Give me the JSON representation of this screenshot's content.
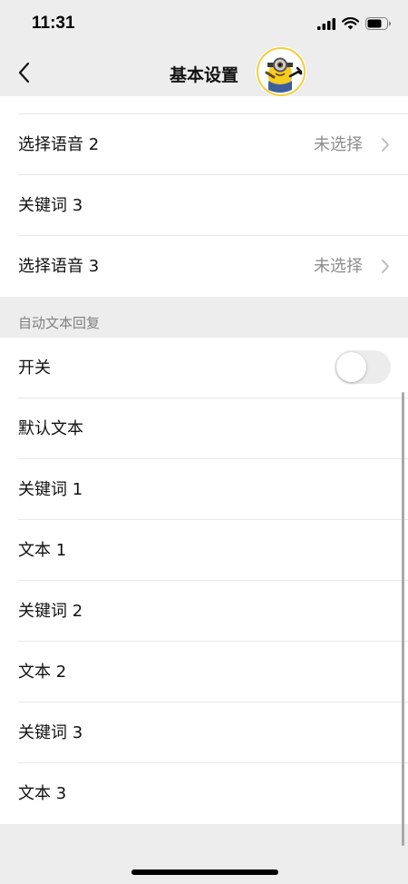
{
  "status_bar": {
    "time": "11:31"
  },
  "nav": {
    "title": "基本设置"
  },
  "voice_section": {
    "rows": [
      {
        "label": "选择语音 2",
        "value": "未选择"
      },
      {
        "label": "关键词 3"
      },
      {
        "label": "选择语音 3",
        "value": "未选择"
      }
    ]
  },
  "text_reply_section": {
    "header": "自动文本回复",
    "switch": {
      "label": "开关",
      "on": false
    },
    "rows": [
      {
        "label": "默认文本"
      },
      {
        "label": "关键词 1"
      },
      {
        "label": "文本 1"
      },
      {
        "label": "关键词 2"
      },
      {
        "label": "文本 2"
      },
      {
        "label": "关键词 3"
      },
      {
        "label": "文本 3"
      }
    ]
  },
  "colors": {
    "background": "#ededed",
    "card": "#ffffff",
    "secondary_text": "#8c8c8c"
  },
  "icons": {
    "back": "chevron-left-icon",
    "row_arrow": "chevron-right-icon"
  }
}
